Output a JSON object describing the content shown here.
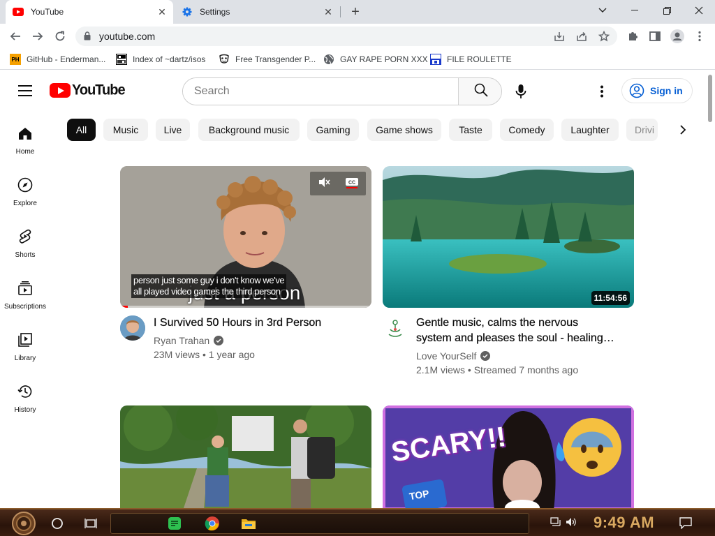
{
  "browser": {
    "tabs": [
      {
        "title": "YouTube",
        "active": true,
        "icon": "youtube-icon"
      },
      {
        "title": "Settings",
        "active": false,
        "icon": "gear-icon"
      }
    ],
    "url": "youtube.com",
    "bookmarks": [
      {
        "label": "GitHub - Enderman...",
        "icon": "ph-icon"
      },
      {
        "label": "Index of ~dartz/isos",
        "icon": "folder-index-icon"
      },
      {
        "label": "Free Transgender P...",
        "icon": "mask-icon"
      },
      {
        "label": "GAY RAPE PORN XXX",
        "icon": "globe-icon"
      },
      {
        "label": "FILE ROULETTE",
        "icon": "mft-icon"
      }
    ]
  },
  "youtube": {
    "logo_text": "YouTube",
    "search": {
      "placeholder": "Search"
    },
    "signin_label": "Sign in",
    "chips": [
      "All",
      "Music",
      "Live",
      "Background music",
      "Gaming",
      "Game shows",
      "Taste",
      "Comedy",
      "Laughter",
      "Drivi"
    ],
    "selected_chip": "All",
    "rail": [
      {
        "label": "Home",
        "icon": "home-icon"
      },
      {
        "label": "Explore",
        "icon": "compass-icon"
      },
      {
        "label": "Shorts",
        "icon": "shorts-icon"
      },
      {
        "label": "Subscriptions",
        "icon": "subscriptions-icon"
      },
      {
        "label": "Library",
        "icon": "library-icon"
      },
      {
        "label": "History",
        "icon": "history-icon"
      }
    ],
    "videos": [
      {
        "title": "I Survived 50 Hours in 3rd Person",
        "channel": "Ryan Trahan",
        "verified": true,
        "meta": "23M views • 1 year ago",
        "caption_line1": "person just some guy i don't know we've",
        "caption_line2": "all played video games the third person",
        "overlay_text": "just a person",
        "progress": 0.03
      },
      {
        "title_line1": "Gentle music, calms the nervous",
        "title_line2": "system and pleases the soul - healing…",
        "channel": "Love YourSelf",
        "verified": true,
        "meta": "2.1M views • Streamed 7 months ago",
        "duration": "11:54:56"
      },
      {
        "title": "",
        "channel": "",
        "meta": ""
      },
      {
        "title": "",
        "channel": "",
        "meta": "",
        "thumb_text": "SCARY!!"
      }
    ]
  },
  "taskbar": {
    "clock": "9:49 AM"
  },
  "colors": {
    "youtube_red": "#ff0000",
    "link_blue": "#065fd4",
    "chip_bg": "#f2f2f2",
    "clock_amber": "#d8a860"
  }
}
